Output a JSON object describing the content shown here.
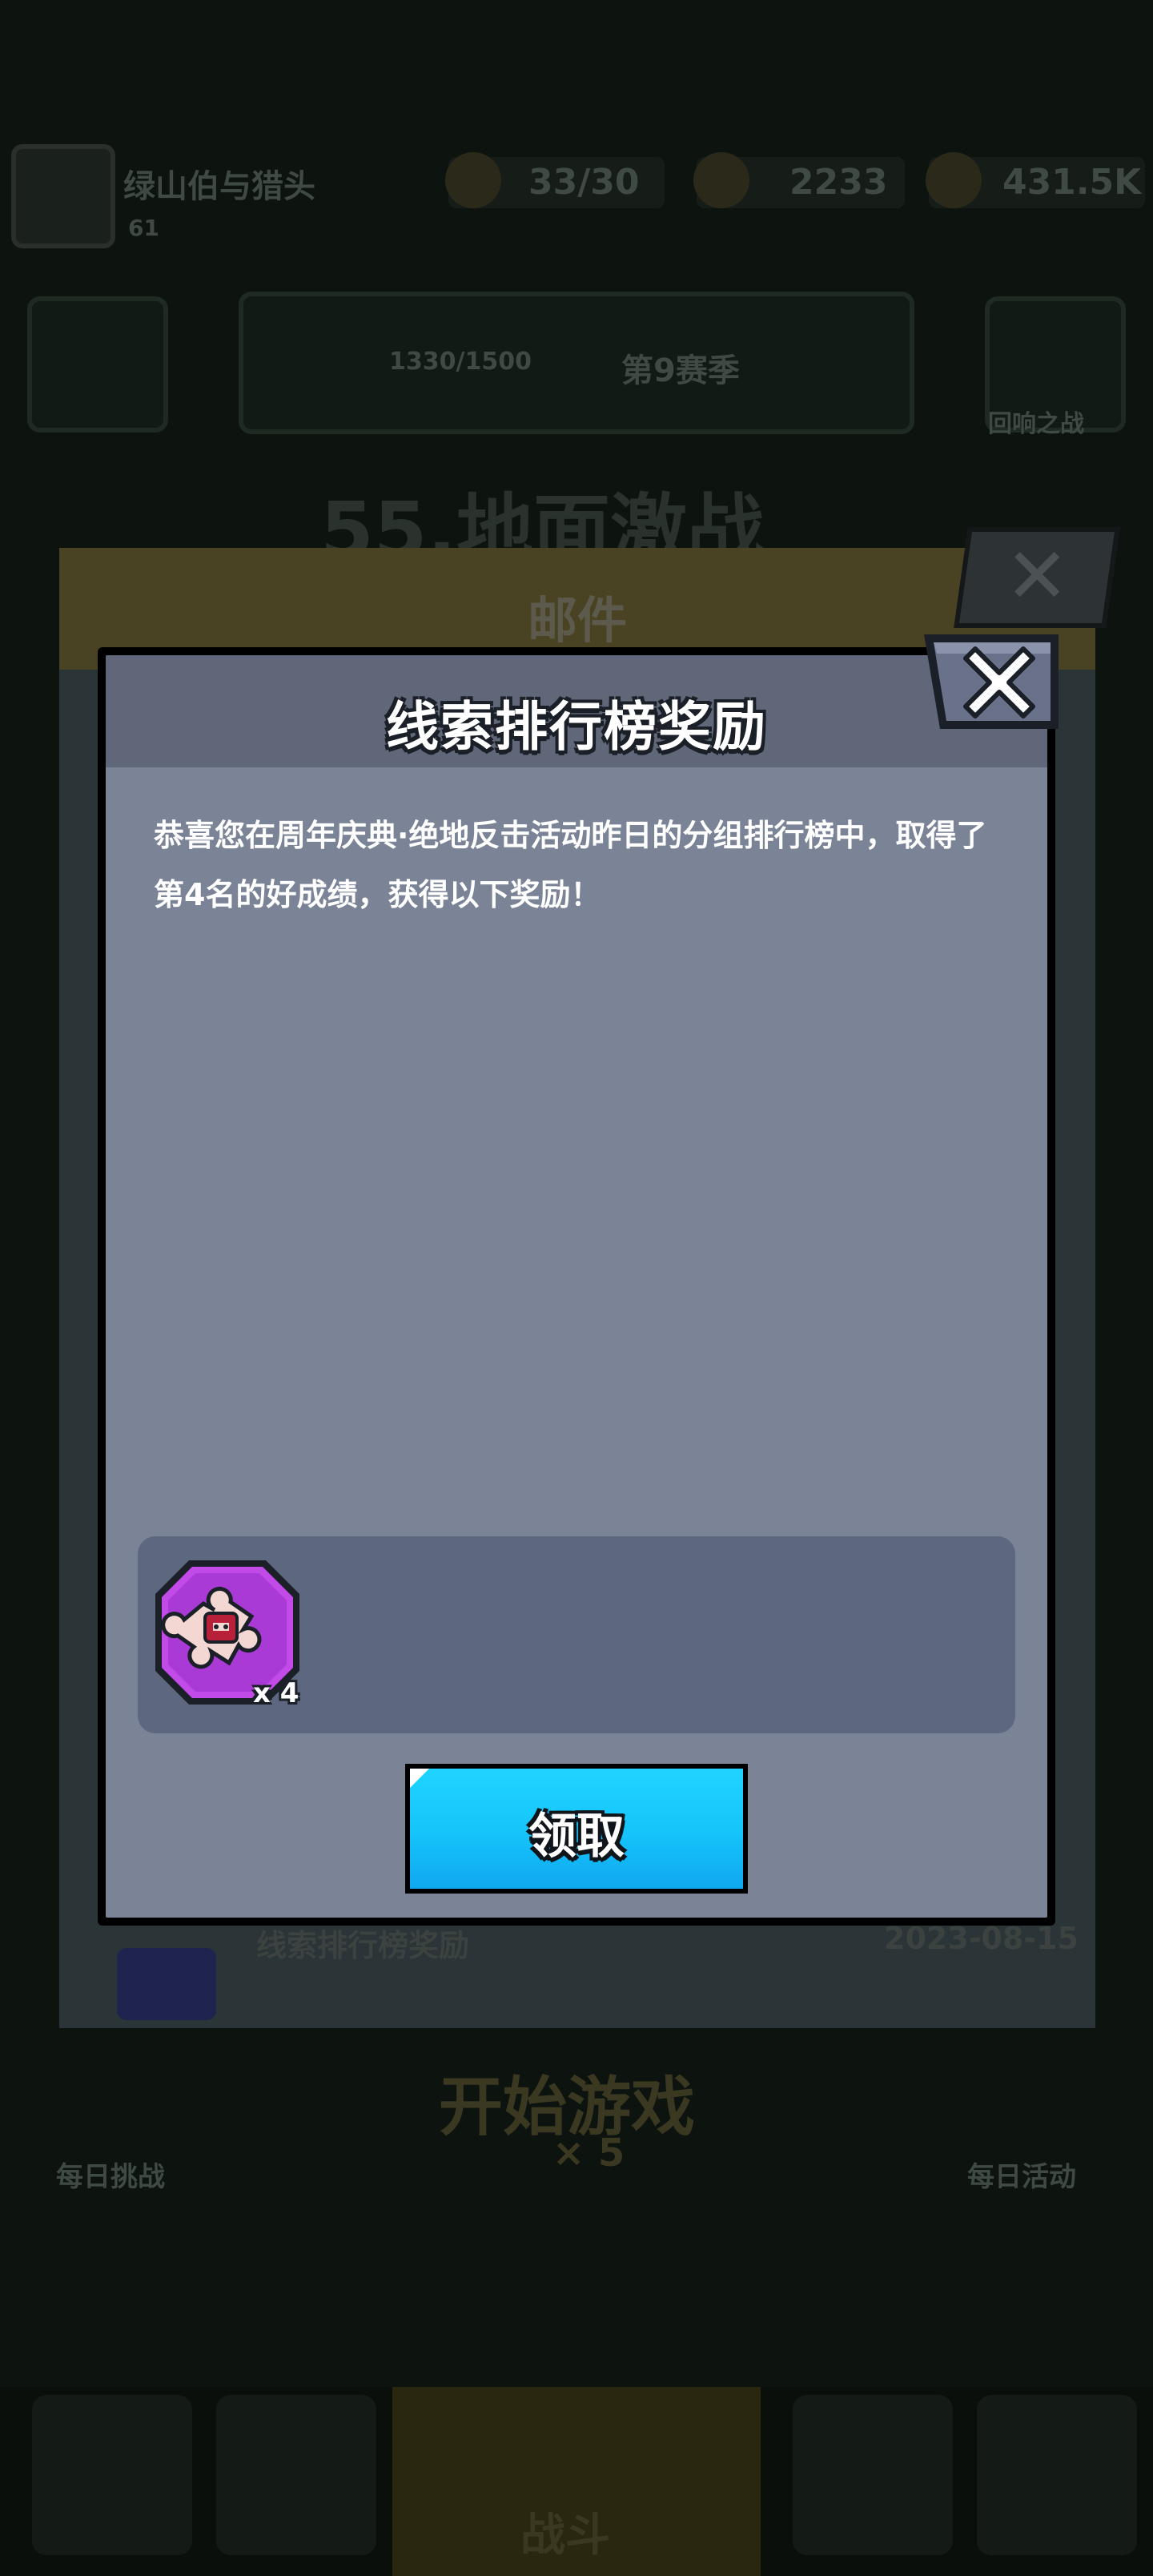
{
  "background": {
    "player_name": "绿山伯与猎头",
    "player_level": "61",
    "stamina": "33/30",
    "gems": "2233",
    "coins": "431.5K",
    "trophy_progress": "1330/1500",
    "rank_text": "第9赛季",
    "side_button_right": "回响之战",
    "stage_title": "55.地面激战",
    "start_game": "开始游戏",
    "start_cost": "× 5",
    "nav_left": "每日挑战",
    "nav_right": "每日活动",
    "nav_center": "战斗"
  },
  "mail": {
    "title": "邮件",
    "row_title": "线索排行榜奖励",
    "row_date": "2023-08-15"
  },
  "dialog": {
    "title": "线索排行榜奖励",
    "message": "恭喜您在周年庆典·绝地反击活动昨日的分组排行榜中，取得了第4名的好成绩，获得以下奖励！",
    "reward": {
      "icon": "puzzle-piece-icon",
      "count": "x 4"
    },
    "claim_label": "领取"
  },
  "colors": {
    "dialog_body": "#7b8497",
    "dialog_header": "#5f6778",
    "reward_box": "#5e6780",
    "claim_button": "#16c6fb",
    "reward_frame": "#b13de0"
  }
}
